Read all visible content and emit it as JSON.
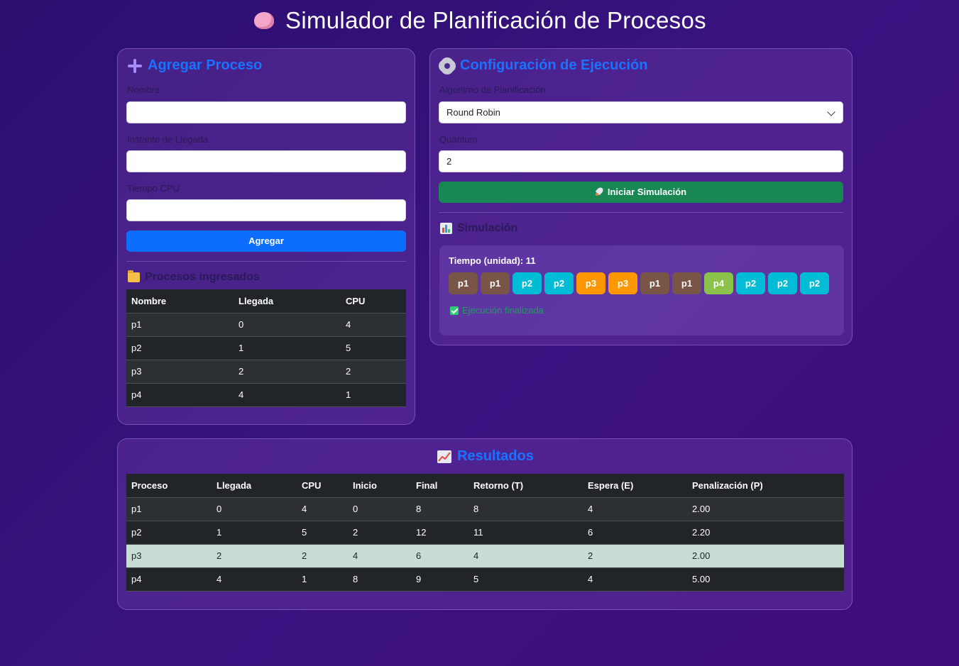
{
  "app_title": "Simulador de Planificación de Procesos",
  "add_process": {
    "title": "Agregar Proceso",
    "name_label": "Nombre",
    "name_value": "",
    "arrival_label": "Instante de Llegada",
    "arrival_value": "",
    "cpu_label": "Tiempo CPU",
    "cpu_value": "",
    "add_button": "Agregar"
  },
  "processes": {
    "title": "Procesos ingresados",
    "headers": [
      "Nombre",
      "Llegada",
      "CPU"
    ],
    "rows": [
      [
        "p1",
        "0",
        "4"
      ],
      [
        "p2",
        "1",
        "5"
      ],
      [
        "p3",
        "2",
        "2"
      ],
      [
        "p4",
        "4",
        "1"
      ]
    ]
  },
  "config": {
    "title": "Configuración de Ejecución",
    "algorithm_label": "Algoritmo de Planificación",
    "algorithm_value": "Round Robin",
    "quantum_label": "Quantum",
    "quantum_value": "2",
    "start_button": "Iniciar Simulación"
  },
  "simulation": {
    "title": "Simulación",
    "time_label": "Tiempo (unidad): 11",
    "blocks": [
      {
        "label": "p1",
        "color": "#795548"
      },
      {
        "label": "p1",
        "color": "#795548"
      },
      {
        "label": "p2",
        "color": "#00bcd4"
      },
      {
        "label": "p2",
        "color": "#00bcd4"
      },
      {
        "label": "p3",
        "color": "#ff9800"
      },
      {
        "label": "p3",
        "color": "#ff9800"
      },
      {
        "label": "p1",
        "color": "#795548"
      },
      {
        "label": "p1",
        "color": "#795548"
      },
      {
        "label": "p4",
        "color": "#8bc34a"
      },
      {
        "label": "p2",
        "color": "#00bcd4"
      },
      {
        "label": "p2",
        "color": "#00bcd4"
      },
      {
        "label": "p2",
        "color": "#00bcd4"
      }
    ],
    "status": "Ejecución finalizada"
  },
  "results": {
    "title": "Resultados",
    "headers": [
      "Proceso",
      "Llegada",
      "CPU",
      "Inicio",
      "Final",
      "Retorno (T)",
      "Espera (E)",
      "Penalización (P)"
    ],
    "rows": [
      [
        "p1",
        "0",
        "4",
        "0",
        "8",
        "8",
        "4",
        "2.00"
      ],
      [
        "p2",
        "1",
        "5",
        "2",
        "12",
        "11",
        "6",
        "2.20"
      ],
      [
        "p3",
        "2",
        "2",
        "4",
        "6",
        "4",
        "2",
        "2.00"
      ],
      [
        "p4",
        "4",
        "1",
        "8",
        "9",
        "5",
        "4",
        "5.00"
      ]
    ],
    "highlighted_row": 2
  }
}
